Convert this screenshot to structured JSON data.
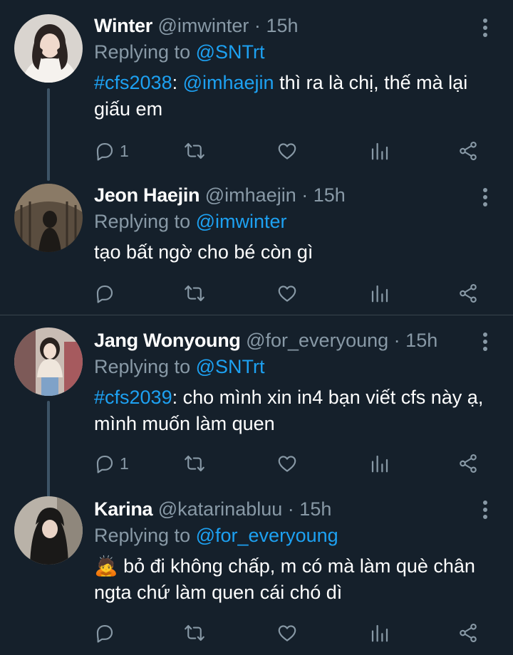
{
  "tweets": [
    {
      "name": "Winter",
      "handle": "@imwinter",
      "dot": "·",
      "time": "15h",
      "replying_label": "Replying to",
      "replying_to": "@SNTrt",
      "body_parts": [
        {
          "text": "#cfs2038",
          "kind": "hashtag"
        },
        {
          "text": ": ",
          "kind": "plain"
        },
        {
          "text": "@imhaejin",
          "kind": "mention"
        },
        {
          "text": " thì ra là chị, thế mà lại giấu em",
          "kind": "plain"
        }
      ],
      "reply_count": "1",
      "retweet_count": "",
      "like_count": ""
    },
    {
      "name": "Jeon Haejin",
      "handle": "@imhaejin",
      "dot": "·",
      "time": "15h",
      "replying_label": "Replying to",
      "replying_to": "@imwinter",
      "body_parts": [
        {
          "text": "tạo bất ngờ cho bé còn gì",
          "kind": "plain"
        }
      ],
      "reply_count": "",
      "retweet_count": "",
      "like_count": ""
    },
    {
      "name": "Jang Wonyoung",
      "handle": "@for_everyoung",
      "dot": "·",
      "time": "15h",
      "replying_label": "Replying to",
      "replying_to": "@SNTrt",
      "body_parts": [
        {
          "text": "#cfs2039",
          "kind": "hashtag"
        },
        {
          "text": ": cho mình xin in4 bạn viết cfs này ạ, mình muốn làm quen",
          "kind": "plain"
        }
      ],
      "reply_count": "1",
      "retweet_count": "",
      "like_count": ""
    },
    {
      "name": "Karina",
      "handle": "@katarinabluu",
      "dot": "·",
      "time": "15h",
      "replying_label": "Replying to",
      "replying_to": "@for_everyoung",
      "body_parts": [
        {
          "text": "🙇",
          "kind": "emoji"
        },
        {
          "text": " bỏ đi không chấp, m có mà làm què chân ngta chứ làm quen cái chó dì",
          "kind": "plain"
        }
      ],
      "reply_count": "",
      "retweet_count": "",
      "like_count": ""
    }
  ],
  "icons": {
    "reply": "reply-icon",
    "retweet": "retweet-icon",
    "like": "heart-icon",
    "analytics": "analytics-icon",
    "share": "share-icon",
    "more": "more-vertical-icon"
  },
  "colors": {
    "background": "#15202b",
    "accent": "#1da1f2",
    "muted": "#8899a6",
    "divider": "#38444d",
    "thread_line": "#3d5466"
  }
}
